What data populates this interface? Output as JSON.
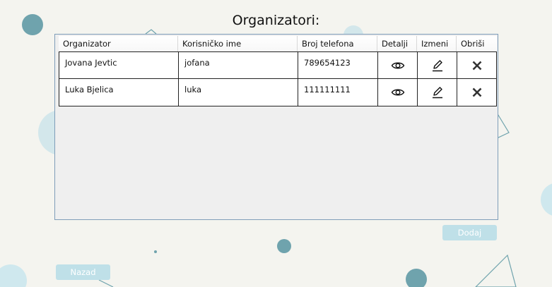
{
  "page": {
    "title": "Organizatori:"
  },
  "table": {
    "columns": [
      "Organizator",
      "Korisničko ime",
      "Broj telefona",
      "Detalji",
      "Izmeni",
      "Obriši"
    ],
    "rows": [
      {
        "organizator": "Jovana Jevtic",
        "username": "jofana",
        "phone": "789654123"
      },
      {
        "organizator": "Luka Bjelica",
        "username": "luka",
        "phone": "111111111"
      }
    ],
    "row_icons": [
      "eye-icon",
      "pencil-icon",
      "close-icon"
    ]
  },
  "buttons": {
    "add_label": "Dodaj",
    "back_label": "Nazad"
  },
  "colors": {
    "background": "#f4f4ef",
    "accent_dark": "#6fa3ad",
    "accent_light": "#bfe0e8",
    "grid_border": "#7f9db9"
  }
}
